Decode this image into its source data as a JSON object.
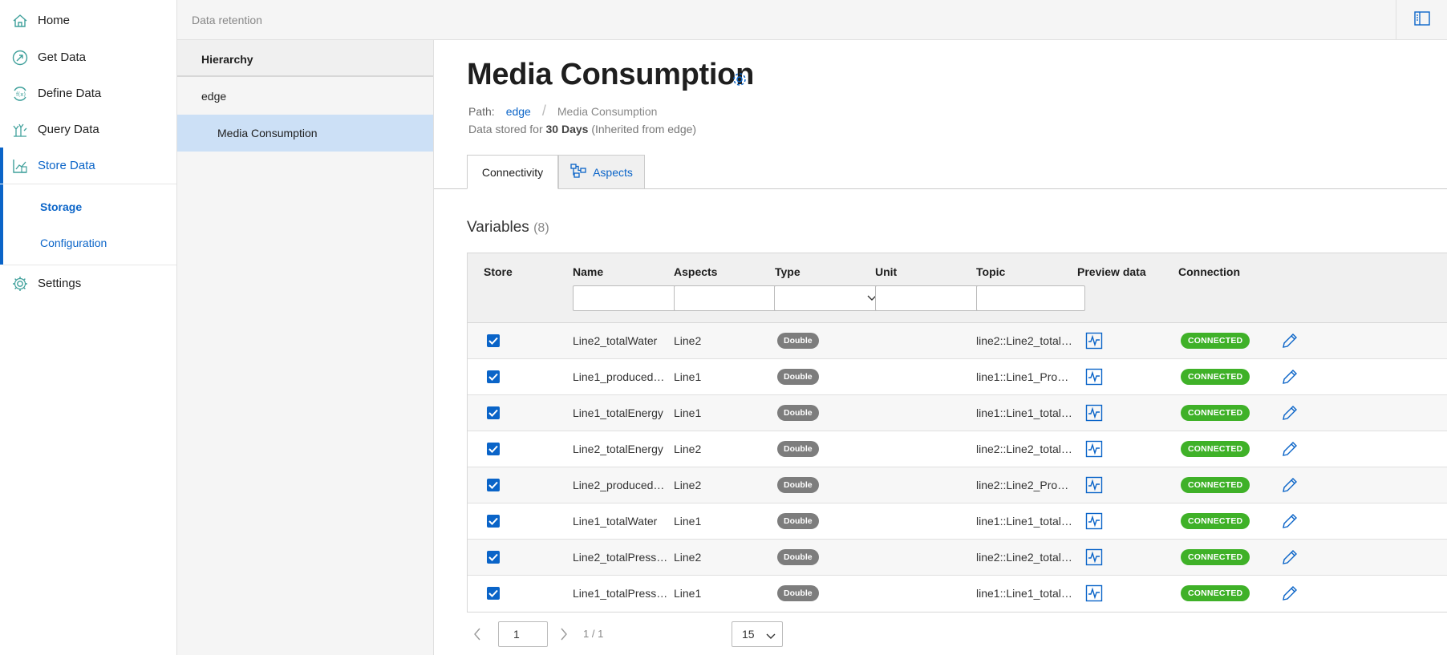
{
  "sidebar": {
    "items": [
      {
        "label": "Home",
        "icon": "home-icon"
      },
      {
        "label": "Get Data",
        "icon": "get-data-icon"
      },
      {
        "label": "Define Data",
        "icon": "define-data-icon"
      },
      {
        "label": "Query Data",
        "icon": "query-data-icon"
      },
      {
        "label": "Store Data",
        "icon": "store-data-icon"
      },
      {
        "label": "Settings",
        "icon": "gear-icon"
      }
    ],
    "subitems": [
      {
        "label": "Storage"
      },
      {
        "label": "Configuration"
      }
    ]
  },
  "header": {
    "breadcrumb": "Data retention"
  },
  "hierarchy": {
    "title": "Hierarchy",
    "nodes": [
      {
        "label": "edge"
      },
      {
        "label": "Media Consumption"
      }
    ]
  },
  "main": {
    "title": "Media Consumption",
    "path_label": "Path:",
    "path_link": "edge",
    "path_current": "Media Consumption",
    "stored_prefix": "Data stored for",
    "stored_value": "30 Days",
    "stored_suffix": "(Inherited from edge)",
    "tabs": [
      {
        "label": "Connectivity"
      },
      {
        "label": "Aspects"
      }
    ],
    "variables_title": "Variables",
    "variables_count": "(8)"
  },
  "table": {
    "headers": {
      "store": "Store",
      "name": "Name",
      "aspects": "Aspects",
      "type": "Type",
      "unit": "Unit",
      "topic": "Topic",
      "preview": "Preview data",
      "connection": "Connection"
    },
    "rows": [
      {
        "name": "Line2_totalWater",
        "aspect": "Line2",
        "type": "Double",
        "unit": "",
        "topic": "line2::Line2_totalWa...",
        "connection": "CONNECTED"
      },
      {
        "name": "Line1_producedBott...",
        "aspect": "Line1",
        "type": "Double",
        "unit": "",
        "topic": "line1::Line1_Produc...",
        "connection": "CONNECTED"
      },
      {
        "name": "Line1_totalEnergy",
        "aspect": "Line1",
        "type": "Double",
        "unit": "",
        "topic": "line1::Line1_totalEn...",
        "connection": "CONNECTED"
      },
      {
        "name": "Line2_totalEnergy",
        "aspect": "Line2",
        "type": "Double",
        "unit": "",
        "topic": "line2::Line2_totalEn...",
        "connection": "CONNECTED"
      },
      {
        "name": "Line2_producedBott...",
        "aspect": "Line2",
        "type": "Double",
        "unit": "",
        "topic": "line2::Line2_Produc...",
        "connection": "CONNECTED"
      },
      {
        "name": "Line1_totalWater",
        "aspect": "Line1",
        "type": "Double",
        "unit": "",
        "topic": "line1::Line1_totalWa...",
        "connection": "CONNECTED"
      },
      {
        "name": "Line2_totalPressure...",
        "aspect": "Line2",
        "type": "Double",
        "unit": "",
        "topic": "line2::Line2_totalPre...",
        "connection": "CONNECTED"
      },
      {
        "name": "Line1_totalPressure...",
        "aspect": "Line1",
        "type": "Double",
        "unit": "",
        "topic": "line1::Line1_totalPre...",
        "connection": "CONNECTED"
      }
    ]
  },
  "pagination": {
    "page": "1",
    "info": "1 / 1",
    "page_size": "15"
  },
  "colors": {
    "accent": "#0a64c8",
    "connected": "#3fb128",
    "type_badge": "#7d7d7d",
    "selected_row": "#cce0f6"
  }
}
